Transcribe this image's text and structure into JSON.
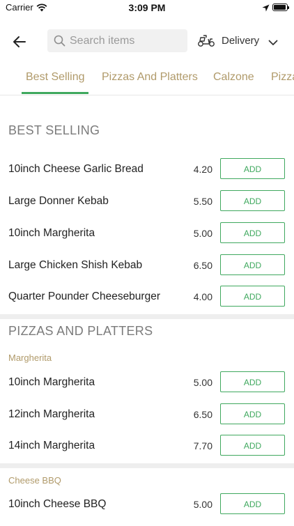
{
  "status": {
    "carrier": "Carrier",
    "time": "3:09 PM"
  },
  "header": {
    "search_placeholder": "Search items",
    "delivery_label": "Delivery"
  },
  "tabs": [
    {
      "label": "Best Selling",
      "active": true
    },
    {
      "label": "Pizzas And Platters"
    },
    {
      "label": "Calzone"
    },
    {
      "label": "Pizza"
    }
  ],
  "colors": {
    "accent": "#3fa85e",
    "category": "#b09a6a"
  },
  "sections": {
    "best_selling": {
      "title": "BEST SELLING",
      "items": [
        {
          "name": "10inch Cheese Garlic Bread",
          "price": "4.20",
          "button": "ADD"
        },
        {
          "name": "Large Donner Kebab",
          "price": "5.50",
          "button": "ADD"
        },
        {
          "name": "10inch Margherita",
          "price": "5.00",
          "button": "ADD"
        },
        {
          "name": "Large Chicken Shish Kebab",
          "price": "6.50",
          "button": "ADD"
        },
        {
          "name": "Quarter Pounder Cheeseburger",
          "price": "4.00",
          "button": "ADD"
        }
      ]
    },
    "pizzas": {
      "title": "PIZZAS AND PLATTERS",
      "groups": [
        {
          "title": "Margherita",
          "items": [
            {
              "name": "10inch Margherita",
              "price": "5.00",
              "button": "ADD"
            },
            {
              "name": "12inch Margherita",
              "price": "6.50",
              "button": "ADD"
            },
            {
              "name": "14inch Margherita",
              "price": "7.70",
              "button": "ADD"
            }
          ]
        },
        {
          "title": "Cheese BBQ",
          "items": [
            {
              "name": "10inch Cheese BBQ",
              "price": "5.00",
              "button": "ADD"
            }
          ]
        }
      ]
    }
  }
}
